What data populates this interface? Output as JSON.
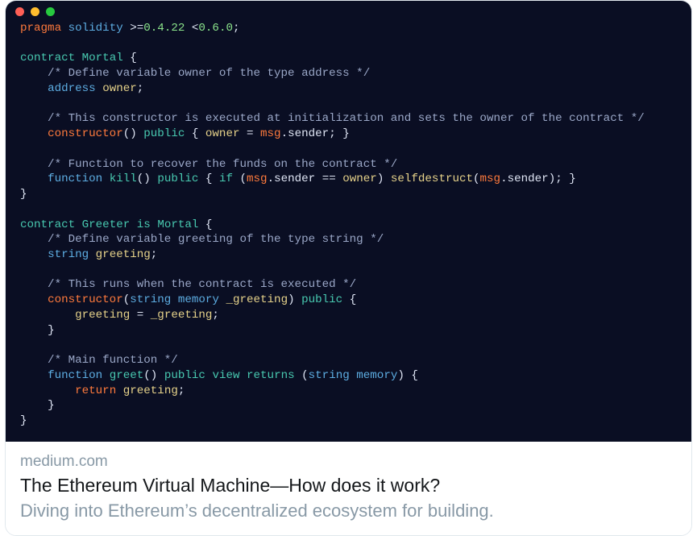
{
  "window": {
    "dots": [
      "red",
      "yellow",
      "green"
    ]
  },
  "code": {
    "tokens": [
      [
        [
          "pragma",
          "pragma"
        ],
        [
          " ",
          "op"
        ],
        [
          "solidity",
          "type"
        ],
        [
          " ",
          "op"
        ],
        [
          ">=",
          "op"
        ],
        [
          "0.4.22",
          "num"
        ],
        [
          " ",
          "op"
        ],
        [
          "<",
          "op"
        ],
        [
          "0.6.0",
          "num"
        ],
        [
          ";",
          "op"
        ]
      ],
      [],
      [
        [
          "contract",
          "keyword"
        ],
        [
          " ",
          "op"
        ],
        [
          "Mortal",
          "name"
        ],
        [
          " ",
          "op"
        ],
        [
          "{",
          "brace"
        ]
      ],
      [
        [
          "    /* Define variable owner of the type address */",
          "comment"
        ]
      ],
      [
        [
          "    ",
          "op"
        ],
        [
          "address",
          "type"
        ],
        [
          " ",
          "op"
        ],
        [
          "owner",
          "ident"
        ],
        [
          ";",
          "op"
        ]
      ],
      [],
      [
        [
          "    /* This constructor is executed at initialization and sets the owner of the contract */",
          "comment"
        ]
      ],
      [
        [
          "    ",
          "op"
        ],
        [
          "constructor",
          "pragma"
        ],
        [
          "()",
          "op"
        ],
        [
          " ",
          "op"
        ],
        [
          "public",
          "keyword"
        ],
        [
          " ",
          "op"
        ],
        [
          "{",
          "brace"
        ],
        [
          " ",
          "op"
        ],
        [
          "owner",
          "ident"
        ],
        [
          " ",
          "op"
        ],
        [
          "=",
          "op"
        ],
        [
          " ",
          "op"
        ],
        [
          "msg",
          "msg"
        ],
        [
          ".",
          "op"
        ],
        [
          "sender",
          "prop"
        ],
        [
          ";",
          "op"
        ],
        [
          " ",
          "op"
        ],
        [
          "}",
          "brace"
        ]
      ],
      [],
      [
        [
          "    /* Function to recover the funds on the contract */",
          "comment"
        ]
      ],
      [
        [
          "    ",
          "op"
        ],
        [
          "function",
          "type"
        ],
        [
          " ",
          "op"
        ],
        [
          "kill",
          "func"
        ],
        [
          "()",
          "op"
        ],
        [
          " ",
          "op"
        ],
        [
          "public",
          "keyword"
        ],
        [
          " ",
          "op"
        ],
        [
          "{",
          "brace"
        ],
        [
          " ",
          "op"
        ],
        [
          "if",
          "keyword"
        ],
        [
          " ",
          "op"
        ],
        [
          "(",
          "op"
        ],
        [
          "msg",
          "msg"
        ],
        [
          ".",
          "op"
        ],
        [
          "sender",
          "prop"
        ],
        [
          " ",
          "op"
        ],
        [
          "==",
          "op"
        ],
        [
          " ",
          "op"
        ],
        [
          "owner",
          "ident"
        ],
        [
          ")",
          "op"
        ],
        [
          " ",
          "op"
        ],
        [
          "selfdestruct",
          "ident"
        ],
        [
          "(",
          "op"
        ],
        [
          "msg",
          "msg"
        ],
        [
          ".",
          "op"
        ],
        [
          "sender",
          "prop"
        ],
        [
          ")",
          "op"
        ],
        [
          ";",
          "op"
        ],
        [
          " ",
          "op"
        ],
        [
          "}",
          "brace"
        ]
      ],
      [
        [
          "}",
          "brace"
        ]
      ],
      [],
      [
        [
          "contract",
          "keyword"
        ],
        [
          " ",
          "op"
        ],
        [
          "Greeter",
          "name"
        ],
        [
          " ",
          "op"
        ],
        [
          "is",
          "keyword"
        ],
        [
          " ",
          "op"
        ],
        [
          "Mortal",
          "name"
        ],
        [
          " ",
          "op"
        ],
        [
          "{",
          "brace"
        ]
      ],
      [
        [
          "    /* Define variable greeting of the type string */",
          "comment"
        ]
      ],
      [
        [
          "    ",
          "op"
        ],
        [
          "string",
          "type"
        ],
        [
          " ",
          "op"
        ],
        [
          "greeting",
          "ident"
        ],
        [
          ";",
          "op"
        ]
      ],
      [],
      [
        [
          "    /* This runs when the contract is executed */",
          "comment"
        ]
      ],
      [
        [
          "    ",
          "op"
        ],
        [
          "constructor",
          "pragma"
        ],
        [
          "(",
          "op"
        ],
        [
          "string",
          "type"
        ],
        [
          " ",
          "op"
        ],
        [
          "memory",
          "type"
        ],
        [
          " ",
          "op"
        ],
        [
          "_greeting",
          "ident"
        ],
        [
          ")",
          "op"
        ],
        [
          " ",
          "op"
        ],
        [
          "public",
          "keyword"
        ],
        [
          " ",
          "op"
        ],
        [
          "{",
          "brace"
        ]
      ],
      [
        [
          "        ",
          "op"
        ],
        [
          "greeting",
          "ident"
        ],
        [
          " ",
          "op"
        ],
        [
          "=",
          "op"
        ],
        [
          " ",
          "op"
        ],
        [
          "_greeting",
          "ident"
        ],
        [
          ";",
          "op"
        ]
      ],
      [
        [
          "    ",
          "op"
        ],
        [
          "}",
          "brace"
        ]
      ],
      [],
      [
        [
          "    /* Main function */",
          "comment"
        ]
      ],
      [
        [
          "    ",
          "op"
        ],
        [
          "function",
          "type"
        ],
        [
          " ",
          "op"
        ],
        [
          "greet",
          "func"
        ],
        [
          "()",
          "op"
        ],
        [
          " ",
          "op"
        ],
        [
          "public",
          "keyword"
        ],
        [
          " ",
          "op"
        ],
        [
          "view",
          "keyword"
        ],
        [
          " ",
          "op"
        ],
        [
          "returns",
          "keyword"
        ],
        [
          " ",
          "op"
        ],
        [
          "(",
          "op"
        ],
        [
          "string",
          "type"
        ],
        [
          " ",
          "op"
        ],
        [
          "memory",
          "type"
        ],
        [
          ")",
          "op"
        ],
        [
          " ",
          "op"
        ],
        [
          "{",
          "brace"
        ]
      ],
      [
        [
          "        ",
          "op"
        ],
        [
          "return",
          "pragma"
        ],
        [
          " ",
          "op"
        ],
        [
          "greeting",
          "ident"
        ],
        [
          ";",
          "op"
        ]
      ],
      [
        [
          "    ",
          "op"
        ],
        [
          "}",
          "brace"
        ]
      ],
      [
        [
          "}",
          "brace"
        ]
      ]
    ]
  },
  "meta": {
    "domain": "medium.com",
    "title": "The Ethereum Virtual Machine—How does it work?",
    "description": "Diving into Ethereum’s decentralized ecosystem for building."
  }
}
